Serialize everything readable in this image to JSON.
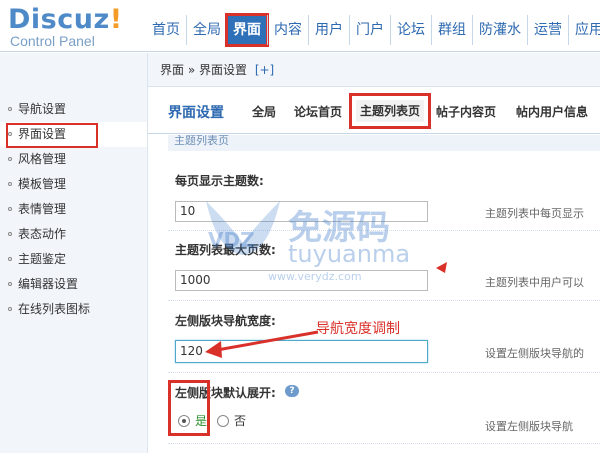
{
  "logo": {
    "main": "Discuz",
    "excl": "!",
    "sub": "Control Panel"
  },
  "topnav": {
    "items": [
      "首页",
      "全局",
      "界面",
      "内容",
      "用户",
      "门户",
      "论坛",
      "群组",
      "防灌水",
      "运营",
      "应用"
    ],
    "active_index": 2
  },
  "breadcrumb": {
    "text": "界面 » 界面设置",
    "plus": "[+]"
  },
  "sidebar": {
    "items": [
      "导航设置",
      "界面设置",
      "风格管理",
      "模板管理",
      "表情管理",
      "表态动作",
      "主题鉴定",
      "编辑器设置",
      "在线列表图标"
    ],
    "active_index": 1
  },
  "tabs": {
    "title": "界面设置",
    "items": [
      "全局",
      "论坛首页",
      "主题列表页",
      "帖子内容页",
      "帖内用户信息"
    ],
    "active_index": 2
  },
  "section": {
    "title": "主题列表页"
  },
  "fields": [
    {
      "label": "每页显示主题数:",
      "value": "10",
      "hint": "主题列表中每页显示"
    },
    {
      "label": "主题列表最大页数:",
      "value": "1000",
      "hint": "主题列表中用户可以"
    },
    {
      "label": "左侧版块导航宽度:",
      "value": "120",
      "hint": "设置左侧版块导航的"
    }
  ],
  "radio_field": {
    "label": "左侧版块默认展开:",
    "help": "?",
    "options": [
      "是",
      "否"
    ],
    "selected_index": 0,
    "hint": "设置左侧版块导航"
  },
  "annotation": {
    "text": "导航宽度调制"
  },
  "watermark": {
    "brand": "免源码",
    "pinyin": "tuyuanma",
    "url": "www.verydz.com",
    "logo": "VDZ"
  },
  "colors": {
    "brand_blue": "#4f8ac8",
    "accent_red": "#d9312a",
    "active_tab": "#2f71b8"
  }
}
